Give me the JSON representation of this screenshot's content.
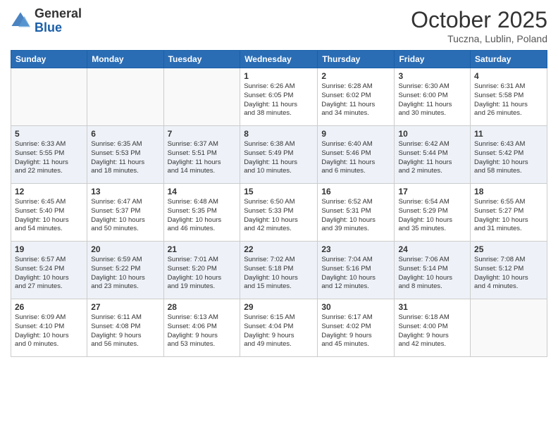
{
  "header": {
    "logo": {
      "general": "General",
      "blue": "Blue"
    },
    "month": "October 2025",
    "location": "Tuczna, Lublin, Poland"
  },
  "days_of_week": [
    "Sunday",
    "Monday",
    "Tuesday",
    "Wednesday",
    "Thursday",
    "Friday",
    "Saturday"
  ],
  "weeks": [
    [
      {
        "day": "",
        "info": ""
      },
      {
        "day": "",
        "info": ""
      },
      {
        "day": "",
        "info": ""
      },
      {
        "day": "1",
        "info": "Sunrise: 6:26 AM\nSunset: 6:05 PM\nDaylight: 11 hours\nand 38 minutes."
      },
      {
        "day": "2",
        "info": "Sunrise: 6:28 AM\nSunset: 6:02 PM\nDaylight: 11 hours\nand 34 minutes."
      },
      {
        "day": "3",
        "info": "Sunrise: 6:30 AM\nSunset: 6:00 PM\nDaylight: 11 hours\nand 30 minutes."
      },
      {
        "day": "4",
        "info": "Sunrise: 6:31 AM\nSunset: 5:58 PM\nDaylight: 11 hours\nand 26 minutes."
      }
    ],
    [
      {
        "day": "5",
        "info": "Sunrise: 6:33 AM\nSunset: 5:55 PM\nDaylight: 11 hours\nand 22 minutes."
      },
      {
        "day": "6",
        "info": "Sunrise: 6:35 AM\nSunset: 5:53 PM\nDaylight: 11 hours\nand 18 minutes."
      },
      {
        "day": "7",
        "info": "Sunrise: 6:37 AM\nSunset: 5:51 PM\nDaylight: 11 hours\nand 14 minutes."
      },
      {
        "day": "8",
        "info": "Sunrise: 6:38 AM\nSunset: 5:49 PM\nDaylight: 11 hours\nand 10 minutes."
      },
      {
        "day": "9",
        "info": "Sunrise: 6:40 AM\nSunset: 5:46 PM\nDaylight: 11 hours\nand 6 minutes."
      },
      {
        "day": "10",
        "info": "Sunrise: 6:42 AM\nSunset: 5:44 PM\nDaylight: 11 hours\nand 2 minutes."
      },
      {
        "day": "11",
        "info": "Sunrise: 6:43 AM\nSunset: 5:42 PM\nDaylight: 10 hours\nand 58 minutes."
      }
    ],
    [
      {
        "day": "12",
        "info": "Sunrise: 6:45 AM\nSunset: 5:40 PM\nDaylight: 10 hours\nand 54 minutes."
      },
      {
        "day": "13",
        "info": "Sunrise: 6:47 AM\nSunset: 5:37 PM\nDaylight: 10 hours\nand 50 minutes."
      },
      {
        "day": "14",
        "info": "Sunrise: 6:48 AM\nSunset: 5:35 PM\nDaylight: 10 hours\nand 46 minutes."
      },
      {
        "day": "15",
        "info": "Sunrise: 6:50 AM\nSunset: 5:33 PM\nDaylight: 10 hours\nand 42 minutes."
      },
      {
        "day": "16",
        "info": "Sunrise: 6:52 AM\nSunset: 5:31 PM\nDaylight: 10 hours\nand 39 minutes."
      },
      {
        "day": "17",
        "info": "Sunrise: 6:54 AM\nSunset: 5:29 PM\nDaylight: 10 hours\nand 35 minutes."
      },
      {
        "day": "18",
        "info": "Sunrise: 6:55 AM\nSunset: 5:27 PM\nDaylight: 10 hours\nand 31 minutes."
      }
    ],
    [
      {
        "day": "19",
        "info": "Sunrise: 6:57 AM\nSunset: 5:24 PM\nDaylight: 10 hours\nand 27 minutes."
      },
      {
        "day": "20",
        "info": "Sunrise: 6:59 AM\nSunset: 5:22 PM\nDaylight: 10 hours\nand 23 minutes."
      },
      {
        "day": "21",
        "info": "Sunrise: 7:01 AM\nSunset: 5:20 PM\nDaylight: 10 hours\nand 19 minutes."
      },
      {
        "day": "22",
        "info": "Sunrise: 7:02 AM\nSunset: 5:18 PM\nDaylight: 10 hours\nand 15 minutes."
      },
      {
        "day": "23",
        "info": "Sunrise: 7:04 AM\nSunset: 5:16 PM\nDaylight: 10 hours\nand 12 minutes."
      },
      {
        "day": "24",
        "info": "Sunrise: 7:06 AM\nSunset: 5:14 PM\nDaylight: 10 hours\nand 8 minutes."
      },
      {
        "day": "25",
        "info": "Sunrise: 7:08 AM\nSunset: 5:12 PM\nDaylight: 10 hours\nand 4 minutes."
      }
    ],
    [
      {
        "day": "26",
        "info": "Sunrise: 6:09 AM\nSunset: 4:10 PM\nDaylight: 10 hours\nand 0 minutes."
      },
      {
        "day": "27",
        "info": "Sunrise: 6:11 AM\nSunset: 4:08 PM\nDaylight: 9 hours\nand 56 minutes."
      },
      {
        "day": "28",
        "info": "Sunrise: 6:13 AM\nSunset: 4:06 PM\nDaylight: 9 hours\nand 53 minutes."
      },
      {
        "day": "29",
        "info": "Sunrise: 6:15 AM\nSunset: 4:04 PM\nDaylight: 9 hours\nand 49 minutes."
      },
      {
        "day": "30",
        "info": "Sunrise: 6:17 AM\nSunset: 4:02 PM\nDaylight: 9 hours\nand 45 minutes."
      },
      {
        "day": "31",
        "info": "Sunrise: 6:18 AM\nSunset: 4:00 PM\nDaylight: 9 hours\nand 42 minutes."
      },
      {
        "day": "",
        "info": ""
      }
    ]
  ]
}
